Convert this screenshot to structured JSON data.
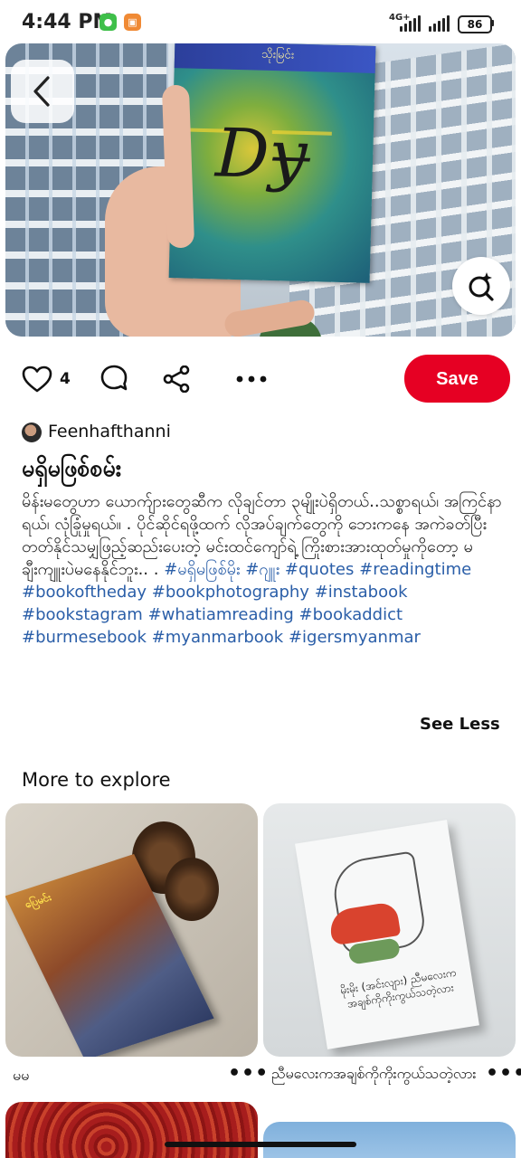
{
  "status_bar": {
    "time": "4:44 PM",
    "network": "4G+",
    "battery": "86"
  },
  "pin": {
    "like_count": "4",
    "save_label": "Save",
    "author": "Feenhafthanni",
    "title": "မရှိမဖြစ်စမ်း",
    "description": "မိန်းမတွေဟာ ယောက်ျားတွေဆီက လိုချင်တာ ၃မျိုးပဲရှိတယ်..သစ္စာရယ်၊ အကြင်နာရယ်၊ လုံခြုံမှုရယ်။ . ပိုင်ဆိုင်ရဖို့ထက် လိုအပ်ချက်တွေကို ဘေးကနေ အကဲခတ်ပြီး တတ်နိုင်သမျှဖြည့်ဆည်းပေးတဲ့ မင်းထင်ကျော်ရဲ့ ကြိုးစားအားထုတ်မှုကိုတော့ မချီးကျူးပဲမနေနိုင်ဘူး.. . ",
    "hashtags": [
      "#မရှိမဖြစ်မိုး",
      "#ဂျူး",
      "#quotes",
      "#readingtime",
      "#bookoftheday",
      "#bookphotography",
      "#instabook",
      "#bookstagram",
      "#whatiamreading",
      "#bookaddict",
      "#burmesebook",
      "#myanmarbook",
      "#igersmyanmar"
    ],
    "see_less_label": "See Less",
    "book_cover_text": "သိုးမြင်း"
  },
  "explore": {
    "section_title": "More to explore",
    "cards": [
      {
        "caption": "မမ",
        "more": "•••",
        "cover_label": "ပြေမင်း"
      },
      {
        "caption": "ညီမလေးကအချစ်ကိုကိုးကွယ်သတဲ့လား",
        "more": "•••",
        "cover_text": "မိုးမိုး (အင်းလျား) ညီမလေးကအချစ်ကိုကိုးကွယ်သတဲ့လား"
      }
    ]
  },
  "icons": {
    "back": "chevron-left-icon",
    "lens": "visual-search-icon",
    "like": "heart-icon",
    "comment": "comment-bubble-icon",
    "share": "share-icon",
    "more": "more-horizontal-icon"
  },
  "colors": {
    "save_button": "#e60023",
    "hashtag": "#2a5ea8"
  }
}
